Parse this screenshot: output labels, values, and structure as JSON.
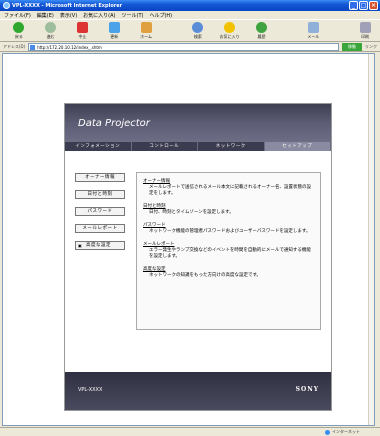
{
  "window": {
    "title": "VPL-XXXX - Microsoft Internet Explorer",
    "min_label": "_",
    "max_label": "□",
    "close_label": "×"
  },
  "menubar": [
    "ファイル(F)",
    "編集(E)",
    "表示(V)",
    "お気に入り(A)",
    "ツール(T)",
    "ヘルプ(H)"
  ],
  "toolbar": {
    "back": "戻る",
    "forward": "進む",
    "stop": "中止",
    "refresh": "更新",
    "home": "ホーム",
    "search": "検索",
    "favorites": "お気に入り",
    "history": "履歴",
    "mail": "メール",
    "print": "印刷"
  },
  "addressbar": {
    "label": "アドレス(D)",
    "url": "http://172.20.10.12/index_.shtm",
    "go": "移動",
    "links": "リンク"
  },
  "page": {
    "header_title": "Data Projector",
    "tabs": [
      "インフォメーション",
      "コントロール",
      "ネットワーク",
      "セットアップ"
    ],
    "nav": [
      "オーナー情報",
      "日付と時刻",
      "パスワード",
      "メールレポート",
      "高度な設定"
    ],
    "sections": [
      {
        "title": "オーナー情報",
        "desc": "メールレポートで送信されるメール本文に記載されるオーナー名、設置状態の設定をします。"
      },
      {
        "title": "日付と時刻",
        "desc": "日付、時刻とタイムゾーンを設定します。"
      },
      {
        "title": "パスワード",
        "desc": "ネットワーク機能の管理者パスワードおよびユーザーパスワードを設定します。"
      },
      {
        "title": "メールレポート",
        "desc": "エラー発生やランプ交換などのイベントを時間を自動的にメールで通知する機能を設定します。"
      },
      {
        "title": "高度な設定",
        "desc": "ネットワークの知識をもった方向けの高度な設定です。"
      }
    ],
    "footer_model": "VPL-XXXX",
    "footer_brand": "SONY"
  },
  "statusbar": {
    "left": "",
    "zone": "インターネット"
  },
  "colors": {
    "titlebar": "#0a44c4",
    "header_dark": "#3f3f52",
    "tab_active": "#8a8aa0"
  }
}
